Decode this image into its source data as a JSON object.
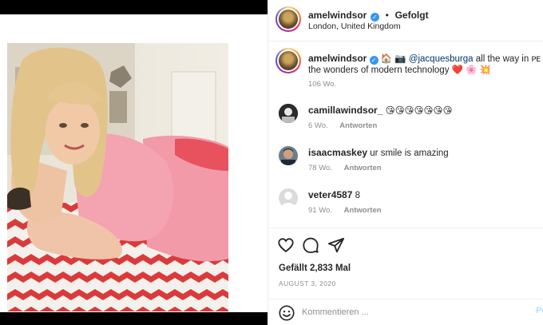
{
  "post": {
    "username": "amelwindsor",
    "follow_status": "Gefolgt",
    "location": "London, United Kingdom",
    "caption_start": "🏠 📷",
    "caption_mention": "@jacquesburga",
    "caption_mid": "all the way in",
    "caption_tail_glyphs": "ᴘᴇ ❤️ c",
    "caption_line2": "the wonders of modern technology ❤️ 🌸 💥",
    "caption_age": "106 Wo.",
    "likes": "Gefällt 2,833 Mal",
    "date": "AUGUST 3, 2020"
  },
  "comments": [
    {
      "username": "camillawindsor_",
      "text": "😘😘😘😘😘😘😘",
      "age": "6 Wo.",
      "reply_label": "Antworten"
    },
    {
      "username": "isaacmaskey",
      "text": "ur smile is amazing",
      "age": "78 Wo.",
      "reply_label": "Antworten"
    },
    {
      "username": "veter4587",
      "text": "8",
      "age": "91 Wo.",
      "reply_label": "Antworten"
    }
  ],
  "composer": {
    "placeholder": "Kommentieren ...",
    "post_label": "Po"
  },
  "icons": {
    "verified": "verified-badge-icon",
    "like": "heart-icon",
    "comment": "comment-bubble-icon",
    "share": "paper-plane-icon",
    "emoji": "smiley-icon"
  },
  "colors": {
    "verified": "#3897f0",
    "mention": "#00376b",
    "meta": "#8e8e8e",
    "post_btn_disabled": "#b2dffc",
    "divider": "#efefef"
  }
}
